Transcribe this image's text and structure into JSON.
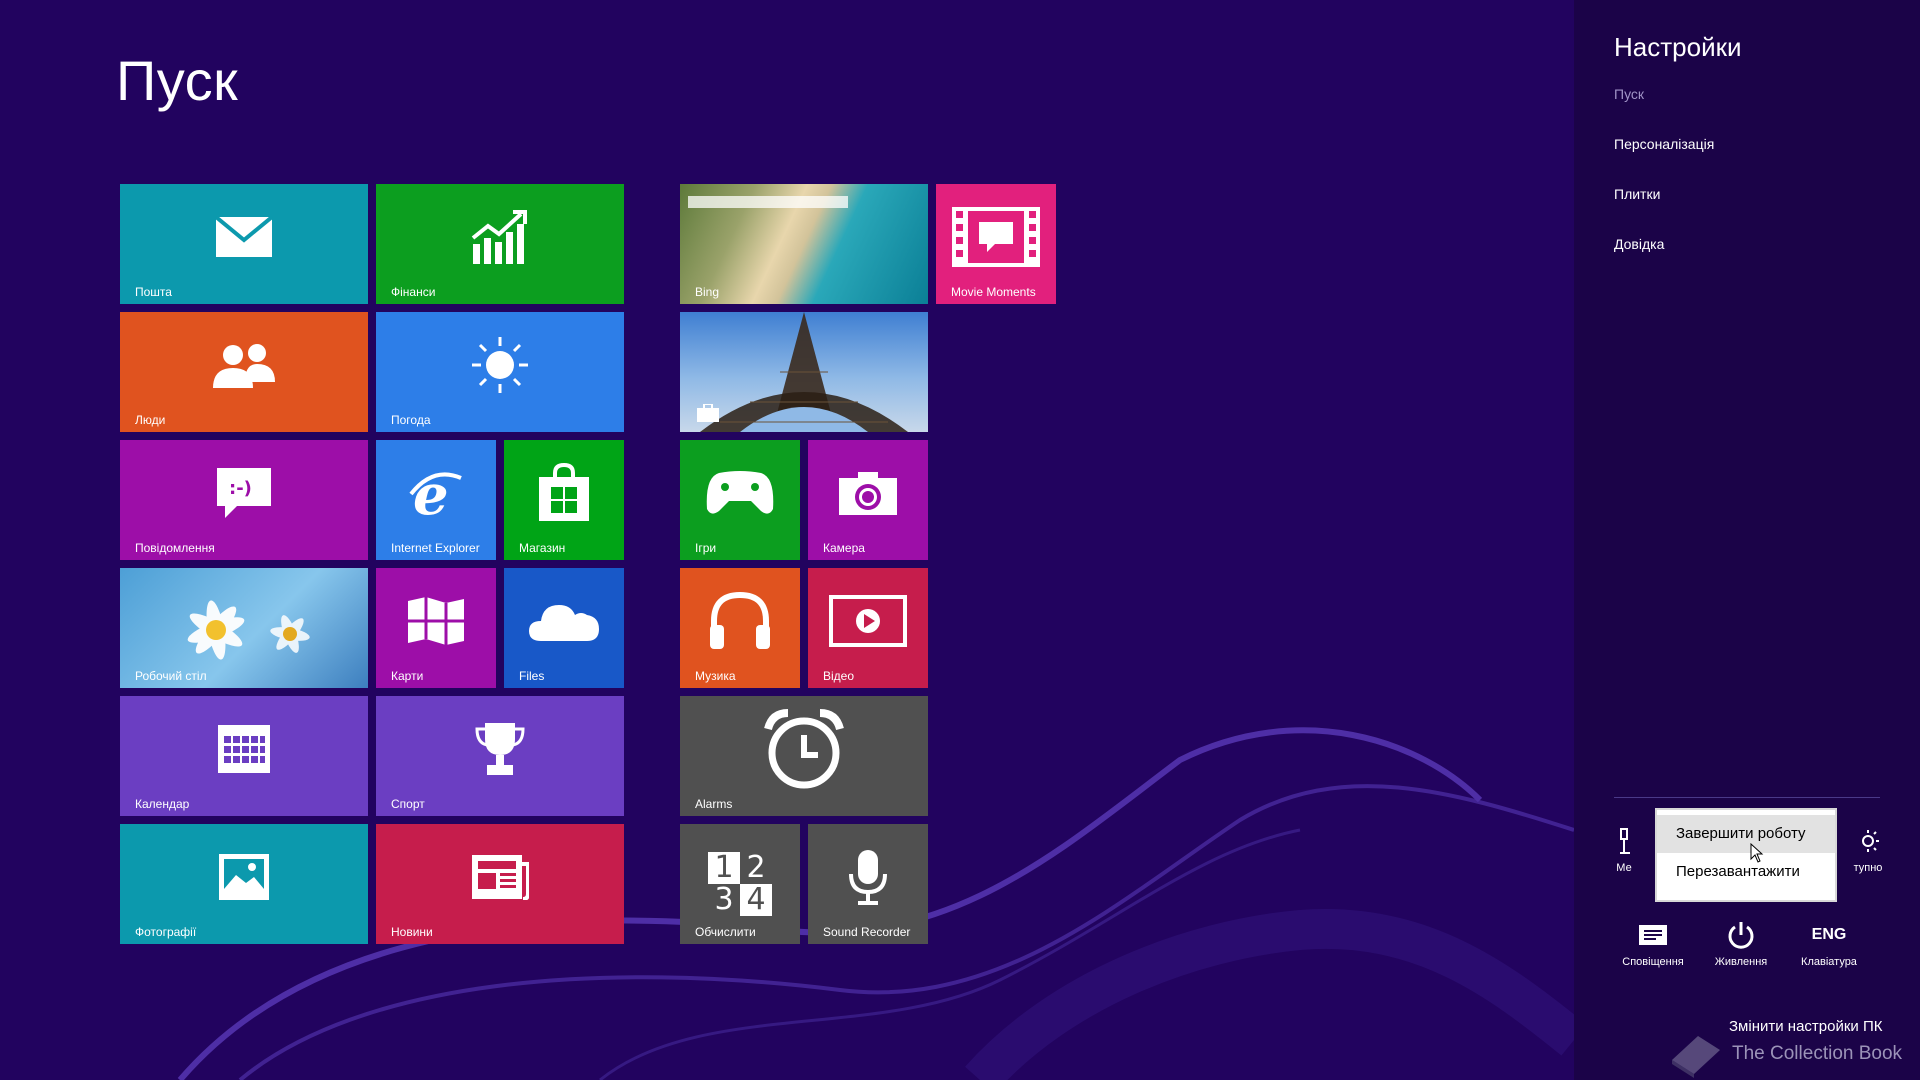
{
  "start": {
    "title": "Пуск"
  },
  "tiles": {
    "mail": "Пошта",
    "finance": "Фінанси",
    "bing": "Bing",
    "movie_moments": "Movie Moments",
    "people": "Люди",
    "weather": "Погода",
    "messaging": "Повідомлення",
    "ie": "Internet Explorer",
    "store": "Магазин",
    "games": "Ігри",
    "camera": "Камера",
    "desktop": "Робочий стіл",
    "maps": "Карти",
    "files": "Files",
    "music": "Музика",
    "video": "Відео",
    "calendar": "Календар",
    "sports": "Спорт",
    "alarms": "Alarms",
    "photos": "Фотографії",
    "news": "Новини",
    "calculator": "Обчислити",
    "sound_recorder": "Sound Recorder",
    "calc_digits": [
      "1",
      "2",
      "3",
      "4"
    ]
  },
  "charms": {
    "title": "Настройки",
    "links": [
      "Пуск",
      "Персоналізація",
      "Плитки",
      "Довідка"
    ],
    "quick": {
      "network_partial": "Ме",
      "brightness_partial": "тупно",
      "notifications": "Сповіщення",
      "power": "Живлення",
      "keyboard_code": "ENG",
      "keyboard": "Клавіатура"
    },
    "power_menu": [
      "Завершити роботу",
      "Перезавантажити"
    ],
    "change_pc_settings": "Змінити настройки ПК"
  },
  "watermark": "The Collection Book",
  "colors": {
    "background": "#22035f",
    "charms_bg": "#1b0348",
    "teal": "#0c99ad",
    "green": "#0c9e1f",
    "orange": "#e0531f",
    "blue": "#2d7ee8",
    "magenta": "#9d0ea8",
    "purple": "#6b3ec2",
    "crimson": "#c61d4c",
    "pink": "#e2207d",
    "gray": "#505050",
    "store_green": "#00a416",
    "skydrive_blue": "#1858c8"
  }
}
